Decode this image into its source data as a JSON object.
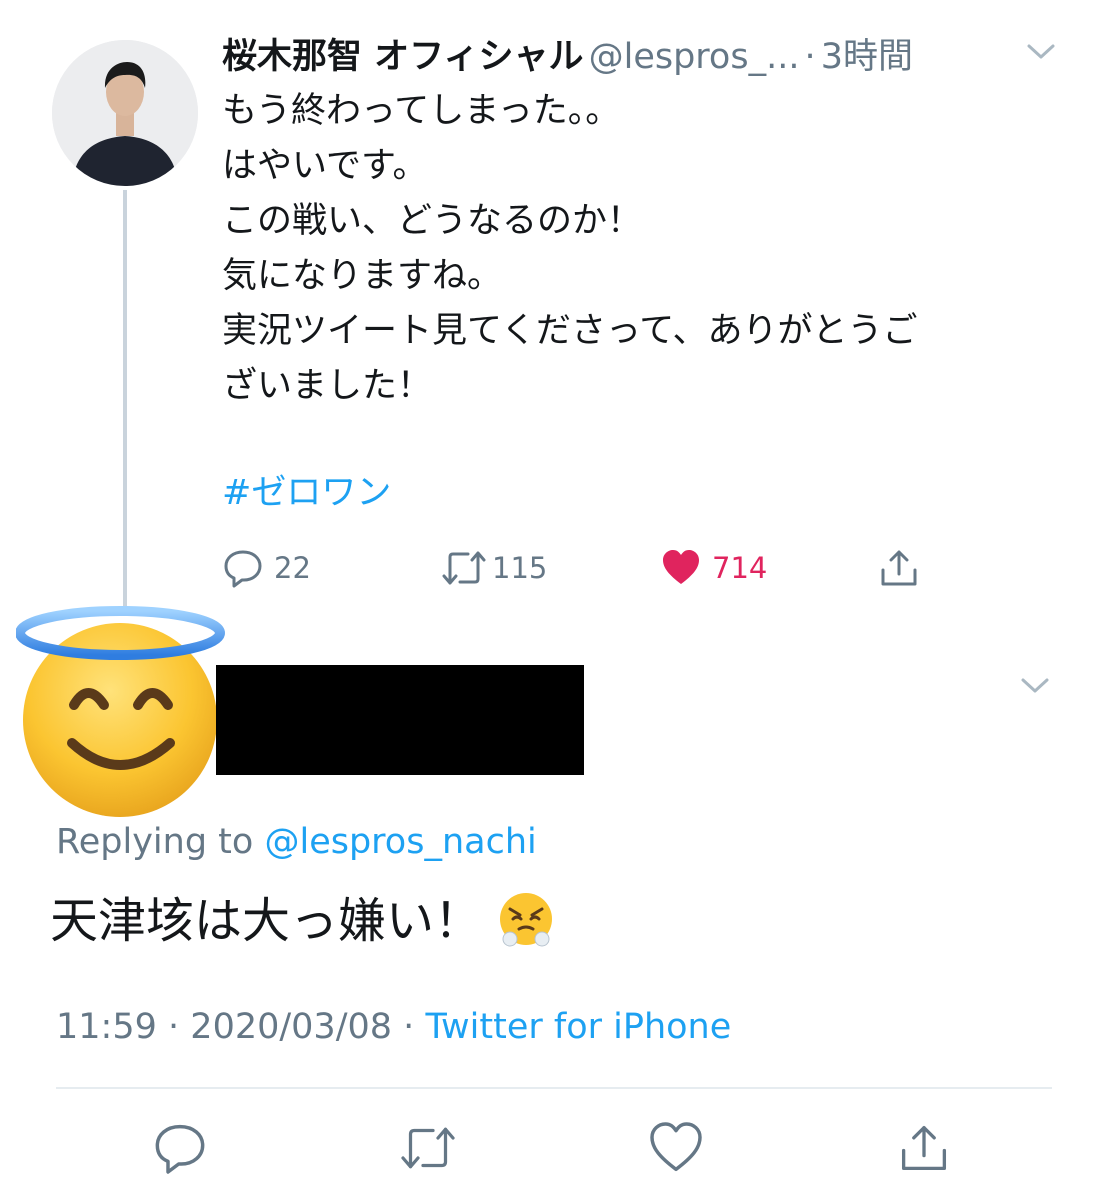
{
  "tweet": {
    "display_name": "桜木那智 オフィシャル",
    "handle": "@lespros_...",
    "separator": "·",
    "time": "3時間",
    "lines": [
      "もう終わってしまった。。",
      "はやいです。",
      "この戦い、どうなるのか！",
      "気になりますね。",
      "実況ツイート見てくださって、ありがとうご",
      "ざいました！"
    ],
    "hashtag": "#ゼロワン",
    "actions": {
      "reply_count": "22",
      "retweet_count": "115",
      "like_count": "714"
    }
  },
  "reply": {
    "replying_prefix": "Replying to",
    "replying_handle": "@lespros_nachi",
    "text": "天津垓は大っ嫌い！",
    "time": "11:59",
    "date": "2020/03/08",
    "separator": "·",
    "source": "Twitter for iPhone"
  },
  "colors": {
    "accent": "#1da1f2",
    "like": "#e0245e",
    "muted": "#657786",
    "thread_line": "#c9d3dc"
  },
  "icons": {
    "reply": "reply-icon",
    "retweet": "retweet-icon",
    "like": "heart-icon",
    "share": "share-icon",
    "caret": "chevron-down-icon",
    "avatar_overlay": "smiling-face-with-halo-emoji",
    "inline_emoji": "face-with-steam-from-nose-emoji"
  }
}
